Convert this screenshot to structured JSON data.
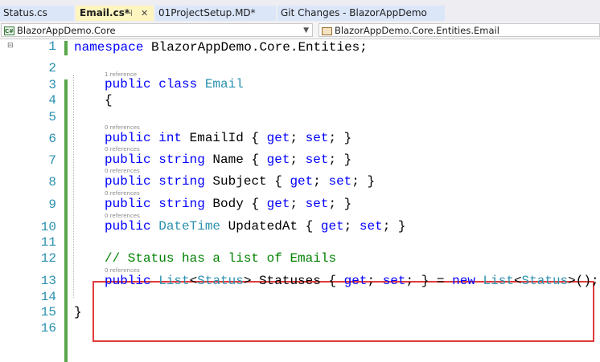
{
  "tabs": [
    {
      "label": "Status.cs"
    },
    {
      "label": "Email.cs*",
      "pin": "⊣",
      "close": "✕"
    },
    {
      "label": "01ProjectSetup.MD*"
    },
    {
      "label": "Git Changes - BlazorAppDemo"
    }
  ],
  "navbar": {
    "project": "BlazorAppDemo.Core",
    "project_icon": "C#",
    "class": "BlazorAppDemo.Core.Entities.Email"
  },
  "editor": {
    "line_numbers": [
      "1",
      "2",
      "3",
      "4",
      "5",
      "6",
      "7",
      "8",
      "9",
      "10",
      "11",
      "12",
      "13",
      "14",
      "15",
      "16"
    ],
    "lens": {
      "class_refs": "1 reference",
      "l6": "0 references",
      "l7": "0 references",
      "l8": "0 references",
      "l9": "0 references",
      "l10": "0 references",
      "l13": "0 references"
    },
    "code": {
      "l1_kw": "namespace",
      "l1_rest": " BlazorAppDemo.Core.Entities;",
      "l3_kw": "public class",
      "l3_ty": "Email",
      "l4": "{",
      "l6_kw": "public int",
      "l6_rest": " EmailId { ",
      "l6_get": "get",
      "l6_set": "set",
      "l7_kw": "public string",
      "l7_rest": " Name { ",
      "l8_kw": "public string",
      "l8_rest": " Subject { ",
      "l9_kw": "public string",
      "l9_rest": " Body { ",
      "l10_kw": "public",
      "l10_ty": "DateTime",
      "l10_rest": " UpdatedAt { ",
      "l12_comment": "// Status has a list of Emails",
      "l13_kw": "public",
      "l13_list": "List",
      "l13_status": "Status",
      "l13_mid": "> Statuses { ",
      "l13_new": "new",
      "l13_end": ">();",
      "l15": "}",
      "get_kw": "get",
      "set_kw": "set"
    }
  }
}
